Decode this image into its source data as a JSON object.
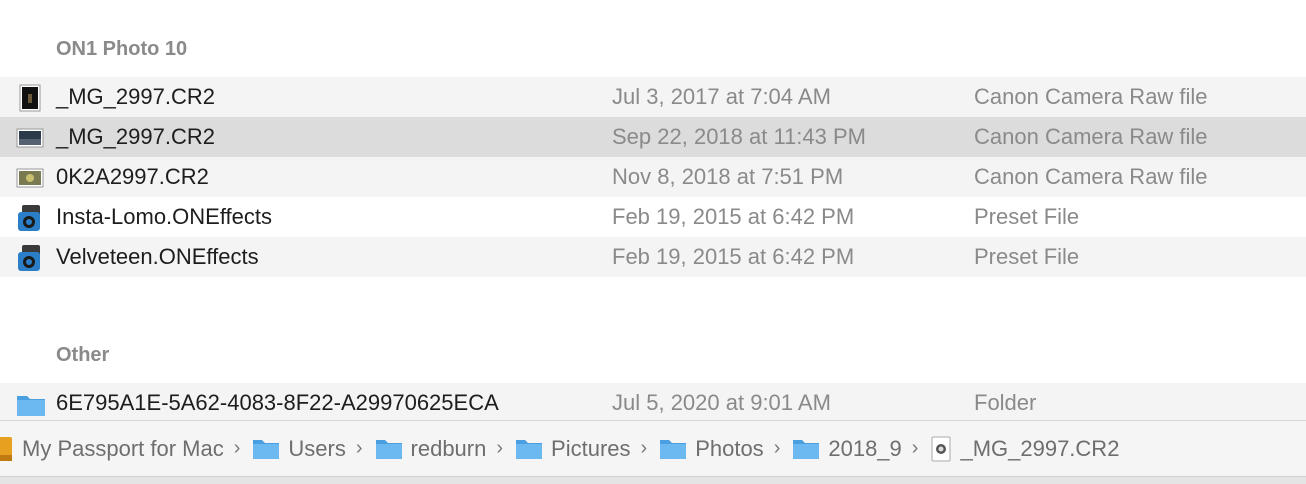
{
  "sections": [
    {
      "title": "ON1 Photo 10",
      "rows": [
        {
          "name": "_MG_2997.CR2",
          "date": "Jul 3, 2017 at 7:04 AM",
          "kind": "Canon Camera Raw file",
          "icon": "raw-photo-thumbnail-icon"
        },
        {
          "name": "_MG_2997.CR2",
          "date": "Sep 22, 2018 at 11:43 PM",
          "kind": "Canon Camera Raw file",
          "icon": "raw-photo-thumbnail-icon"
        },
        {
          "name": "0K2A2997.CR2",
          "date": "Nov 8, 2018 at 7:51 PM",
          "kind": "Canon Camera Raw file",
          "icon": "raw-photo-thumbnail-icon"
        },
        {
          "name": "Insta-Lomo.ONEffects",
          "date": "Feb 19, 2015 at 6:42 PM",
          "kind": "Preset File",
          "icon": "preset-file-icon"
        },
        {
          "name": "Velveteen.ONEffects",
          "date": "Feb 19, 2015 at 6:42 PM",
          "kind": "Preset File",
          "icon": "preset-file-icon"
        }
      ]
    },
    {
      "title": "Other",
      "rows": [
        {
          "name": "6E795A1E-5A62-4083-8F22-A29970625ECA",
          "date": "Jul 5, 2020 at 9:01 AM",
          "kind": "Folder",
          "icon": "folder-icon"
        }
      ]
    }
  ],
  "pathbar": {
    "items": [
      {
        "label": "My Passport for Mac",
        "icon": "external-drive-icon"
      },
      {
        "label": "Users",
        "icon": "folder-icon"
      },
      {
        "label": "redburn",
        "icon": "folder-icon"
      },
      {
        "label": "Pictures",
        "icon": "folder-icon"
      },
      {
        "label": "Photos",
        "icon": "folder-icon"
      },
      {
        "label": "2018_9",
        "icon": "folder-icon"
      },
      {
        "label": "_MG_2997.CR2",
        "icon": "raw-file-icon"
      }
    ],
    "separator": "›"
  },
  "colors": {
    "folder_blue": "#5aaeea",
    "selected_row": "#dcdcdc",
    "stripe": "#f4f4f4",
    "secondary_text": "#8a8a8a"
  }
}
